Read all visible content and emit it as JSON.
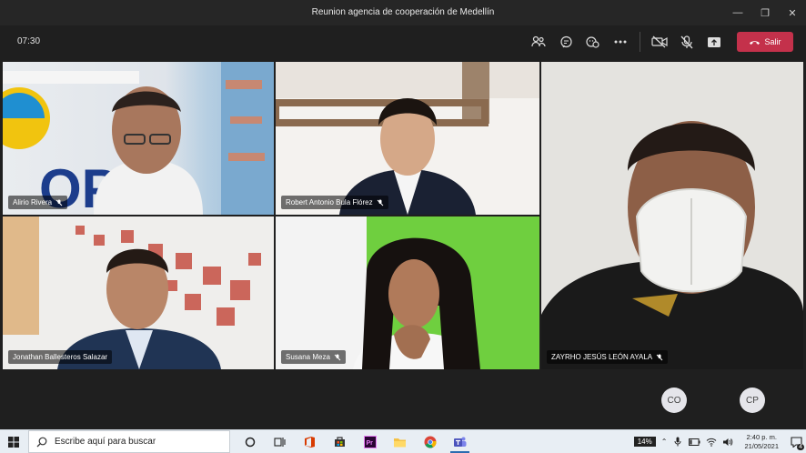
{
  "window": {
    "title": "Reunion agencia de cooperación de Medellín"
  },
  "toolbar": {
    "timer": "07:30",
    "leave_label": "Salir"
  },
  "participants": [
    {
      "name": "Alirio Rivera"
    },
    {
      "name": "Robert Antonio Bula Flórez"
    },
    {
      "name": "ZAYRHO JESÚS LEÓN AYALA"
    },
    {
      "name": "Jonathan Ballesteros Salazar"
    },
    {
      "name": "Susana Meza"
    }
  ],
  "avatars": [
    {
      "initials": "CO"
    },
    {
      "initials": "CP"
    }
  ],
  "taskbar": {
    "search_placeholder": "Escribe aquí para buscar",
    "battery": "14%",
    "time": "2:40 p. m.",
    "date": "21/05/2021",
    "notification_count": "4"
  },
  "colors": {
    "leave": "#c4314b",
    "background": "#1f1f1f",
    "taskbar": "#e8eef4"
  }
}
